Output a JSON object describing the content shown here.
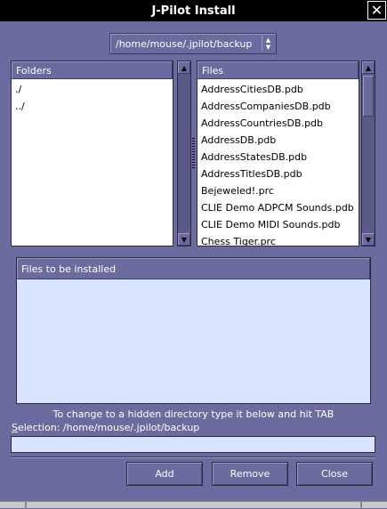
{
  "window": {
    "title": "J-Pilot Install",
    "close_glyph": "✕"
  },
  "path_combo": {
    "value": "/home/mouse/.jpilot/backup"
  },
  "folders": {
    "header": "Folders",
    "items": [
      "./",
      "../"
    ]
  },
  "files": {
    "header": "Files",
    "items": [
      "AddressCitiesDB.pdb",
      "AddressCompaniesDB.pdb",
      "AddressCountriesDB.pdb",
      "AddressDB.pdb",
      "AddressStatesDB.pdb",
      "AddressTitlesDB.pdb",
      "Bejeweled!.prc",
      "CLIE Demo ADPCM Sounds.pdb",
      "CLIE Demo MIDI Sounds.pdb",
      "Chess Tiger.prc"
    ]
  },
  "install_list": {
    "header": "Files to be installed",
    "items": []
  },
  "hint": "To change to a hidden directory type it below and hit TAB",
  "selection": {
    "label_mnemonic": "S",
    "label_rest": "election: /home/mouse/.jpilot/backup",
    "value": ""
  },
  "buttons": {
    "add": "Add",
    "remove": "Remove",
    "close": "Close"
  },
  "icons": {
    "close": "close-icon",
    "combo_arrows": "up-down-arrows-icon",
    "scroll_up": "arrow-up-icon",
    "scroll_down": "arrow-down-icon"
  },
  "colors": {
    "window_bg": "#6b6b9f",
    "titlebar": "#000000",
    "list_bg": "#ffffff",
    "install_bg": "#d8e4ff"
  }
}
